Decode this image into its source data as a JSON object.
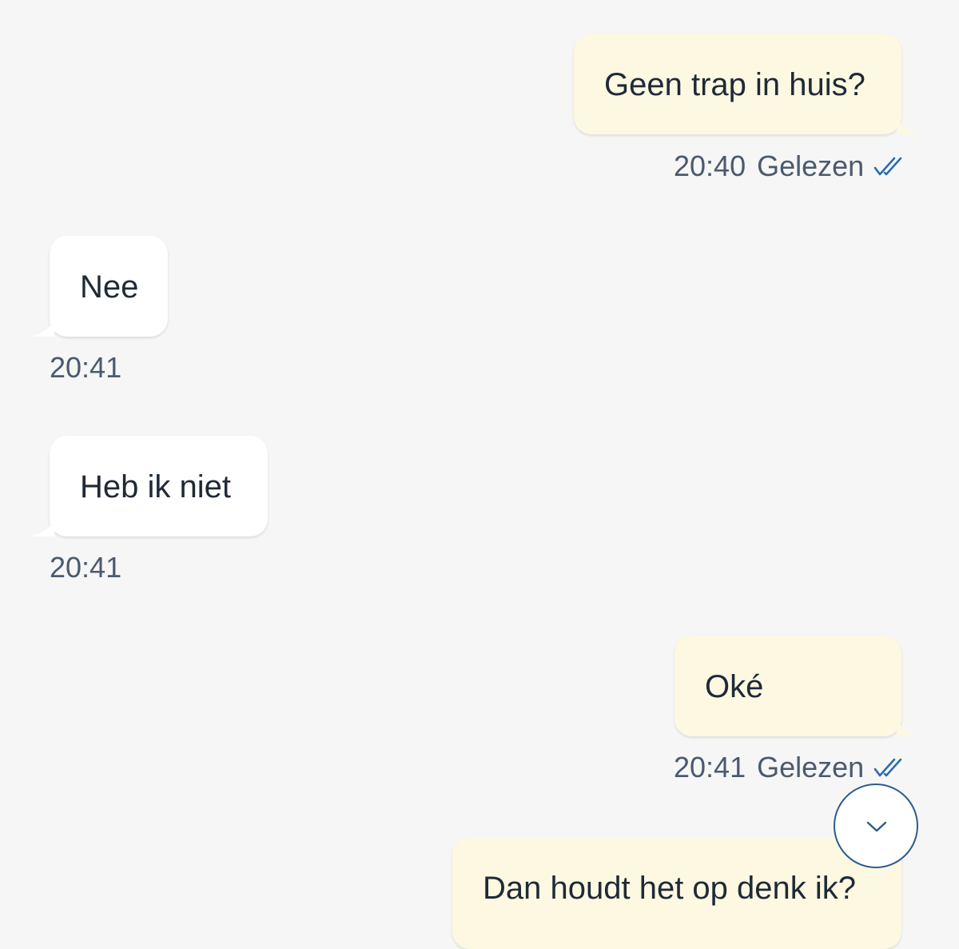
{
  "messages": [
    {
      "direction": "out",
      "text": "Geen trap in huis?",
      "time": "20:40",
      "status": "Gelezen",
      "status_icon": "double-check-icon"
    },
    {
      "direction": "in",
      "text": "Nee",
      "time": "20:41"
    },
    {
      "direction": "in",
      "text": "Heb ik niet",
      "time": "20:41"
    },
    {
      "direction": "out",
      "text": "Oké",
      "time": "20:41",
      "status": "Gelezen",
      "status_icon": "double-check-icon"
    },
    {
      "direction": "out",
      "text": "Dan houdt het op denk ik?"
    }
  ],
  "scroll_button": {
    "icon": "chevron-down-icon"
  },
  "colors": {
    "background": "#f6f6f6",
    "outgoing_bubble": "#fdf8e1",
    "incoming_bubble": "#ffffff",
    "text": "#1f2a37",
    "meta_text": "#4b5a6e",
    "read_check": "#2b6cb0"
  }
}
